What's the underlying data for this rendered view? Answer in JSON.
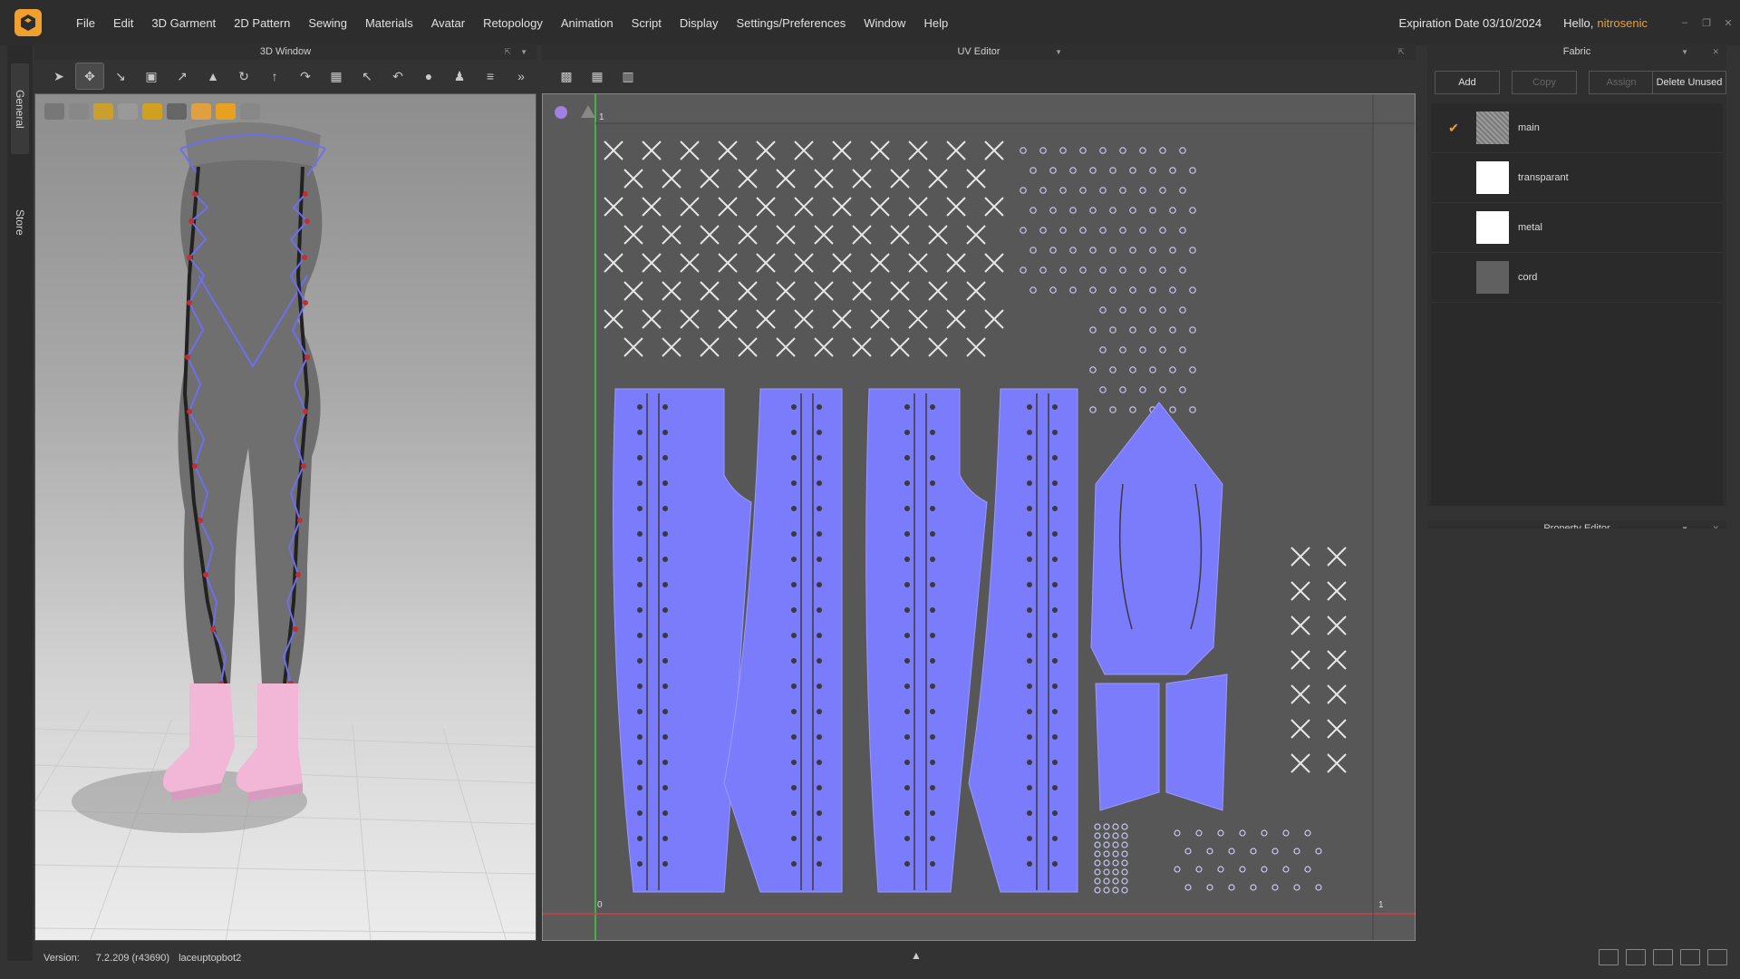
{
  "menubar": {
    "items": [
      "File",
      "Edit",
      "3D Garment",
      "2D Pattern",
      "Sewing",
      "Materials",
      "Avatar",
      "Retopology",
      "Animation",
      "Script",
      "Display",
      "Settings/Preferences",
      "Window",
      "Help"
    ],
    "expiration": "Expiration Date 03/10/2024",
    "hello": "Hello,",
    "username": "nitrosenic",
    "accent_color": "#f0a030"
  },
  "side_tabs": {
    "general": "General",
    "store": "Store"
  },
  "window3d": {
    "title": "3D Window",
    "dropdown_icon": "dropdown-arrow-icon"
  },
  "uv_editor": {
    "title": "UV Editor",
    "axis_origin": "0",
    "axis_max_x": "1",
    "axis_max_y": "1",
    "pattern_color": "#7b7cfb"
  },
  "fabric": {
    "title": "Fabric",
    "buttons": {
      "add": "Add",
      "copy": "Copy",
      "assign": "Assign",
      "delete_unused": "Delete Unused"
    },
    "items": [
      {
        "name": "main",
        "swatch": "#8a8a8a",
        "selected": true,
        "check": "✔"
      },
      {
        "name": "transparant",
        "swatch": "#ffffff",
        "selected": false,
        "check": ""
      },
      {
        "name": "metal",
        "swatch": "#ffffff",
        "selected": false,
        "check": ""
      },
      {
        "name": "cord",
        "swatch": "#606060",
        "selected": false,
        "check": ""
      }
    ]
  },
  "property_editor": {
    "title": "Property Editor"
  },
  "status": {
    "label": "Version:",
    "version": "7.2.209 (r43690)",
    "file": "laceuptopbot2"
  }
}
